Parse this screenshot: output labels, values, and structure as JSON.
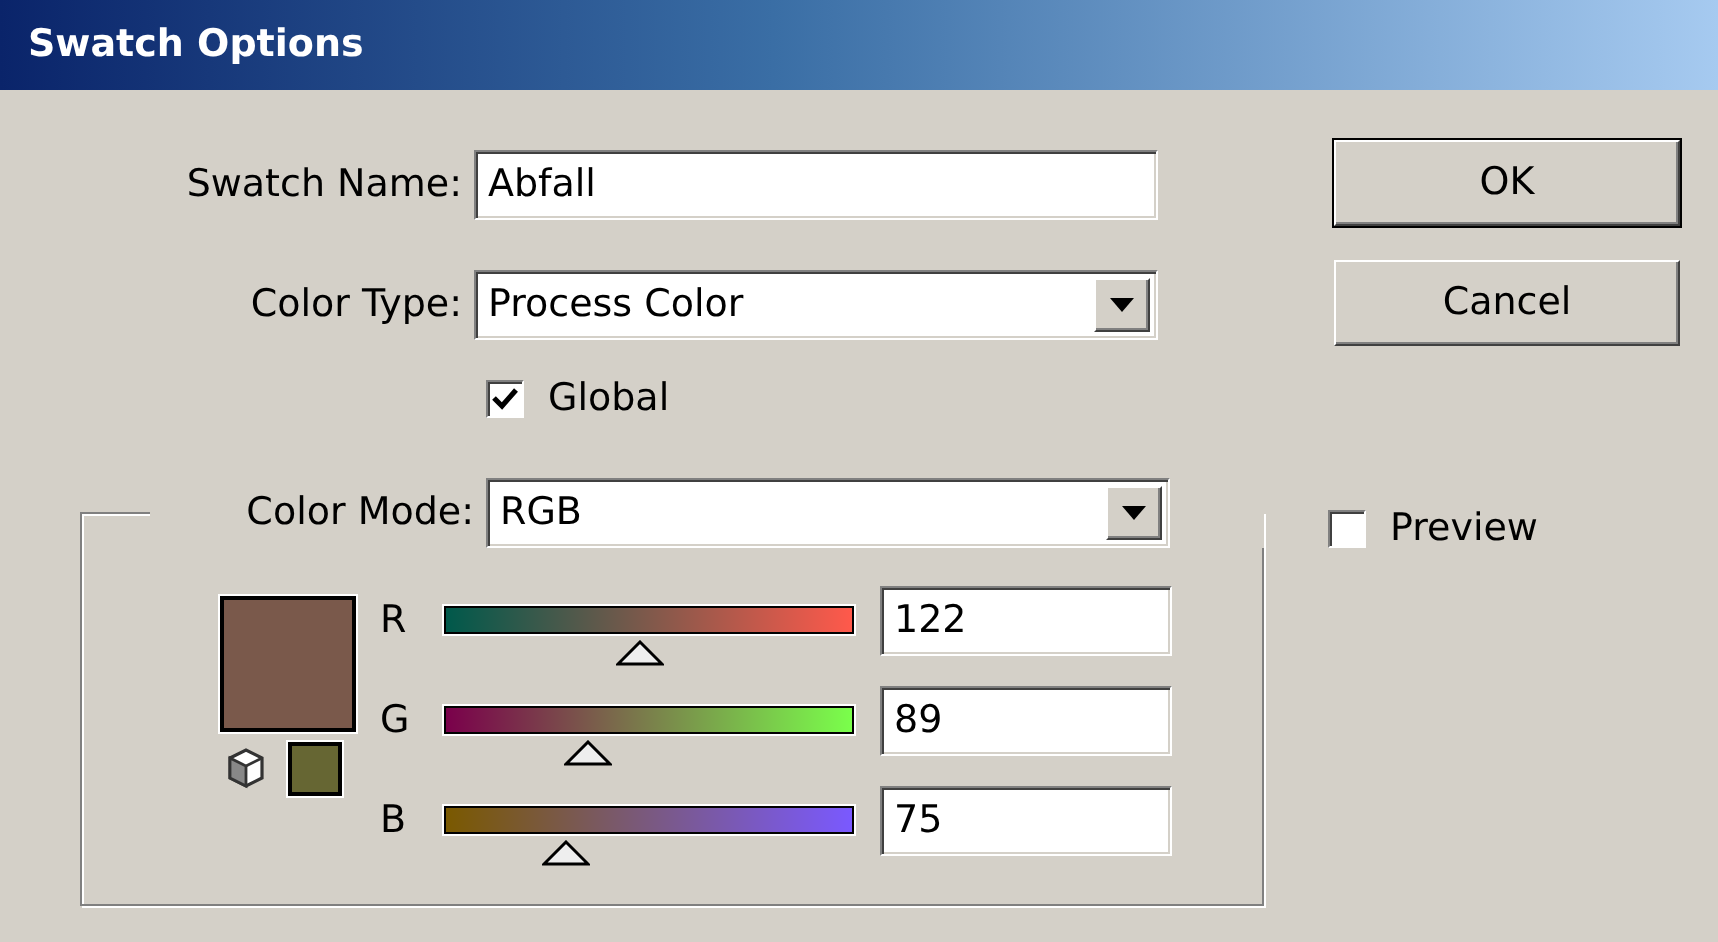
{
  "window": {
    "title": "Swatch Options"
  },
  "swatch_name": {
    "label": "Swatch Name:",
    "value": "Abfall"
  },
  "color_type": {
    "label": "Color Type:",
    "value": "Process Color"
  },
  "global": {
    "label": "Global",
    "checked": true
  },
  "color_mode": {
    "label": "Color Mode:",
    "value": "RGB"
  },
  "gamut_swatch": {
    "color": "#666633"
  },
  "channels": [
    {
      "name": "R",
      "value": "122",
      "level": 0.478
    },
    {
      "name": "G",
      "value": "89",
      "level": 0.349
    },
    {
      "name": "B",
      "value": "75",
      "level": 0.294
    }
  ],
  "buttons": [
    {
      "label": "OK",
      "default": true
    },
    {
      "label": "Cancel",
      "default": false
    }
  ],
  "preview": {
    "label": "Preview",
    "checked": false
  }
}
